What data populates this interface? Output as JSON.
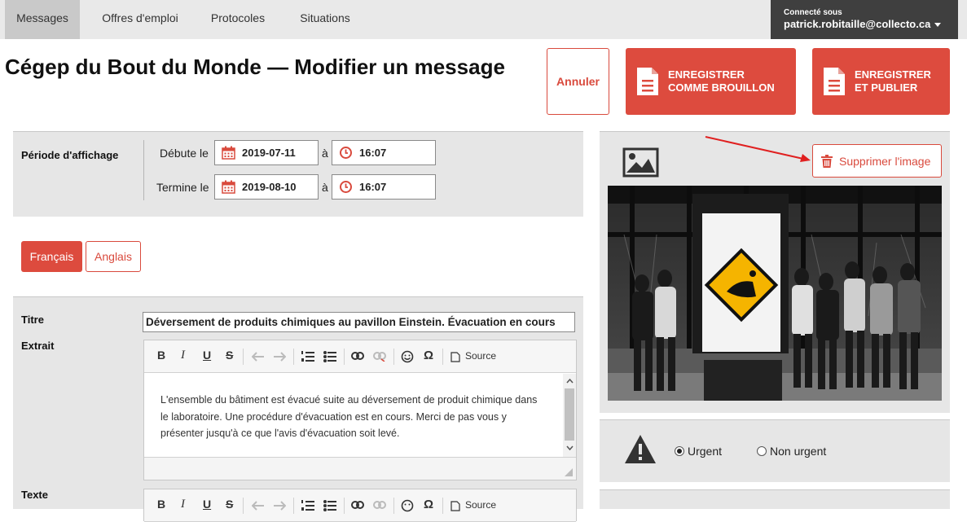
{
  "nav": {
    "tabs": [
      {
        "label": "Messages",
        "active": true
      },
      {
        "label": "Offres d'emploi"
      },
      {
        "label": "Protocoles"
      },
      {
        "label": "Situations"
      }
    ],
    "user_label": "Connecté sous",
    "user_email": "patrick.robitaille@collecto.ca"
  },
  "page": {
    "title": "Cégep du Bout du Monde — Modifier un message"
  },
  "actions": {
    "cancel": "Annuler",
    "save_draft": [
      "ENREGISTRER",
      "COMME BROUILLON"
    ],
    "save_publish": [
      "ENREGISTRER",
      "ET PUBLIER"
    ],
    "accent_color": "#dd4b3e"
  },
  "period": {
    "label": "Période d'affichage",
    "start_label": "Débute le",
    "start_date": "2019-07-11",
    "start_time": "16:07",
    "end_label": "Termine le",
    "end_date": "2019-08-10",
    "end_time": "16:07",
    "at": "à"
  },
  "languages": [
    {
      "label": "Français",
      "active": true
    },
    {
      "label": "Anglais",
      "active": false
    }
  ],
  "form": {
    "title_label": "Titre",
    "title_value": "Déversement de produits chimiques au pavillon Einstein. Évacuation en cours",
    "excerpt_label": "Extrait",
    "excerpt_text": "L'ensemble du bâtiment est évacué suite au déversement de produit chimique dans le laboratoire. Une procédure d'évacuation est en cours. Merci de pas vous y présenter jusqu'à ce que l'avis d'évacuation soit levé.",
    "text_label": "Texte",
    "toolbar": {
      "bold": "B",
      "italic": "I",
      "underline": "U",
      "strike": "S",
      "source": "Source",
      "special_char": "Ω"
    }
  },
  "image_panel": {
    "delete_label": "Supprimer l'image",
    "image_icon": "image-icon",
    "photo_description": "people-walking-past-chemical-hazard-sign"
  },
  "priority": {
    "options": [
      {
        "label": "Urgent",
        "selected": true
      },
      {
        "label": "Non urgent",
        "selected": false
      }
    ]
  }
}
